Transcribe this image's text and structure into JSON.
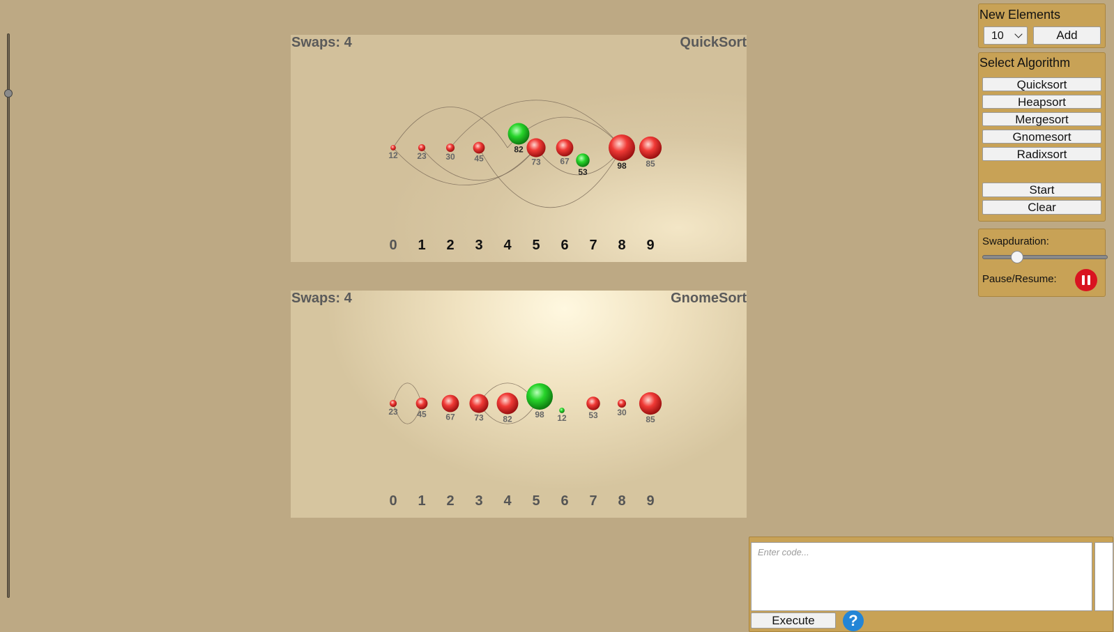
{
  "colors": {
    "background": "#bda984",
    "panel_accent": "#c8a256",
    "sphere_red": "#e0302e",
    "sphere_green": "#27d42a",
    "pause_red": "#d91420",
    "help_blue": "#2385d6"
  },
  "vertical_slider": {
    "value_fraction": 0.1
  },
  "visualizations": [
    {
      "swaps_label": "Swaps: 4",
      "algorithm_name": "QuickSort",
      "indices": [
        "0",
        "1",
        "2",
        "3",
        "4",
        "5",
        "6",
        "7",
        "8",
        "9"
      ],
      "highlighted_indices": [
        1,
        2,
        3,
        4,
        5,
        6,
        7,
        8,
        9
      ],
      "elements": [
        {
          "value": 12,
          "color": "red"
        },
        {
          "value": 23,
          "color": "red"
        },
        {
          "value": 30,
          "color": "red"
        },
        {
          "value": 45,
          "color": "red"
        },
        {
          "value": 82,
          "color": "green"
        },
        {
          "value": 73,
          "color": "red"
        },
        {
          "value": 67,
          "color": "red"
        },
        {
          "value": 53,
          "color": "green"
        },
        {
          "value": 98,
          "color": "red"
        },
        {
          "value": 85,
          "color": "red"
        }
      ]
    },
    {
      "swaps_label": "Swaps: 4",
      "algorithm_name": "GnomeSort",
      "indices": [
        "0",
        "1",
        "2",
        "3",
        "4",
        "5",
        "6",
        "7",
        "8",
        "9"
      ],
      "highlighted_indices": [],
      "elements": [
        {
          "value": 23,
          "color": "red"
        },
        {
          "value": 45,
          "color": "red"
        },
        {
          "value": 67,
          "color": "red"
        },
        {
          "value": 73,
          "color": "red"
        },
        {
          "value": 82,
          "color": "red"
        },
        {
          "value": 98,
          "color": "green"
        },
        {
          "value": 12,
          "color": "green"
        },
        {
          "value": 53,
          "color": "red"
        },
        {
          "value": 30,
          "color": "red"
        },
        {
          "value": 85,
          "color": "red"
        }
      ]
    }
  ],
  "new_elements": {
    "title": "New Elements",
    "count_value": "10",
    "add_label": "Add"
  },
  "algorithms": {
    "title": "Select Algorithm",
    "items": [
      "Quicksort",
      "Heapsort",
      "Mergesort",
      "Gnomesort",
      "Radixsort"
    ],
    "start_label": "Start",
    "clear_label": "Clear"
  },
  "settings": {
    "swapduration_label": "Swapduration:",
    "swapduration_fraction": 0.25,
    "pause_resume_label": "Pause/Resume:",
    "pause_icon": "pause-icon"
  },
  "code": {
    "placeholder": "Enter code...",
    "execute_label": "Execute",
    "help_label": "?"
  }
}
